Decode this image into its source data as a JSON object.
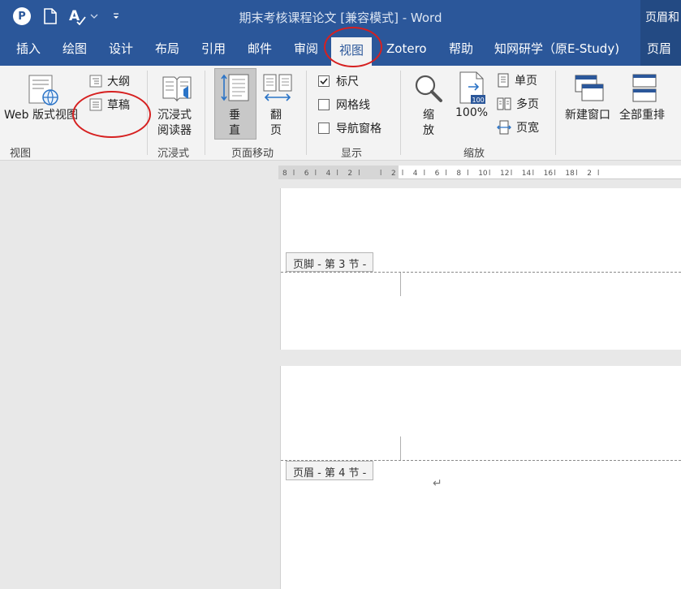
{
  "title_bar": {
    "document_title": "期末考核课程论文 [兼容模式] - Word",
    "right_fragment": "页眉和"
  },
  "tabs": [
    {
      "label": "插入"
    },
    {
      "label": "绘图"
    },
    {
      "label": "设计"
    },
    {
      "label": "布局"
    },
    {
      "label": "引用"
    },
    {
      "label": "邮件"
    },
    {
      "label": "审阅"
    },
    {
      "label": "视图",
      "active": true
    },
    {
      "label": "Zotero"
    },
    {
      "label": "帮助"
    },
    {
      "label": "知网研学（原E-Study)"
    }
  ],
  "tab_right_fragment": "页眉",
  "ribbon": {
    "views_group": {
      "web_layout": "Web 版式视图",
      "outline": "大纲",
      "draft": "草稿",
      "group_label": "视图"
    },
    "immersive_group": {
      "immersive_reader_line1": "沉浸式",
      "immersive_reader_line2": "阅读器",
      "group_label": "沉浸式"
    },
    "page_movement_group": {
      "vertical_line1": "垂",
      "vertical_line2": "直",
      "side_line1": "翻",
      "side_line2": "页",
      "group_label": "页面移动"
    },
    "show_group": {
      "ruler": "标尺",
      "ruler_checked": true,
      "gridlines": "网格线",
      "gridlines_checked": false,
      "nav_pane": "导航窗格",
      "nav_pane_checked": false,
      "group_label": "显示"
    },
    "zoom_group": {
      "zoom_line1": "缩",
      "zoom_line2": "放",
      "hundred_percent": "100%",
      "hundred_icon_text": "100",
      "one_page": "单页",
      "multiple_pages": "多页",
      "page_width": "页宽",
      "group_label": "缩放"
    },
    "window_group": {
      "new_window": "新建窗口",
      "arrange_all": "全部重排"
    }
  },
  "ruler": {
    "ticks": [
      "8",
      "6",
      "4",
      "2",
      "",
      "2",
      "4",
      "6",
      "8",
      "10",
      "12",
      "14",
      "16",
      "18",
      "2"
    ]
  },
  "document": {
    "footer_tag": "页脚 - 第 3 节 -",
    "header_tag": "页眉 - 第 4 节 -",
    "paragraph_mark": "↵"
  },
  "colors": {
    "word_blue": "#2b579a",
    "annotation_red": "#d62020",
    "ribbon_bg": "#f3f3f3"
  }
}
